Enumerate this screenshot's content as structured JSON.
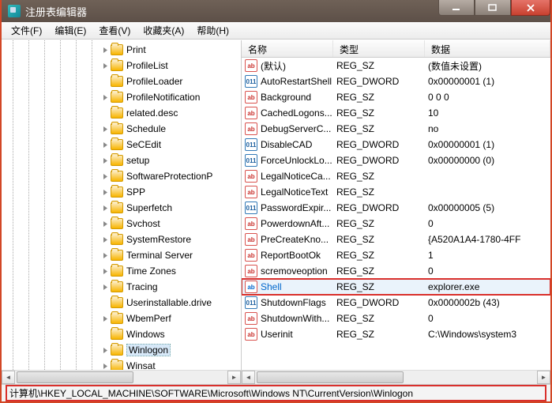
{
  "window": {
    "title": "注册表编辑器"
  },
  "menu": {
    "file": "文件(F)",
    "edit": "编辑(E)",
    "view": "查看(V)",
    "favorites": "收藏夹(A)",
    "help": "帮助(H)"
  },
  "tree": {
    "items": [
      {
        "label": "Print",
        "expandable": true
      },
      {
        "label": "ProfileList",
        "expandable": true
      },
      {
        "label": "ProfileLoader",
        "expandable": false
      },
      {
        "label": "ProfileNotification",
        "expandable": true
      },
      {
        "label": "related.desc",
        "expandable": false
      },
      {
        "label": "Schedule",
        "expandable": true
      },
      {
        "label": "SeCEdit",
        "expandable": true
      },
      {
        "label": "setup",
        "expandable": true
      },
      {
        "label": "SoftwareProtectionP",
        "expandable": true,
        "truncated": true
      },
      {
        "label": "SPP",
        "expandable": true
      },
      {
        "label": "Superfetch",
        "expandable": true
      },
      {
        "label": "Svchost",
        "expandable": true
      },
      {
        "label": "SystemRestore",
        "expandable": true
      },
      {
        "label": "Terminal Server",
        "expandable": true
      },
      {
        "label": "Time Zones",
        "expandable": true
      },
      {
        "label": "Tracing",
        "expandable": true
      },
      {
        "label": "Userinstallable.drive",
        "expandable": false,
        "truncated": true
      },
      {
        "label": "WbemPerf",
        "expandable": true
      },
      {
        "label": "Windows",
        "expandable": false
      },
      {
        "label": "Winlogon",
        "expandable": true,
        "selected": true
      },
      {
        "label": "Winsat",
        "expandable": true,
        "truncated": true
      }
    ]
  },
  "columns": {
    "name": "名称",
    "type": "类型",
    "data": "数据"
  },
  "values": [
    {
      "icon": "sz",
      "name": "(默认)",
      "type": "REG_SZ",
      "data": "(数值未设置)"
    },
    {
      "icon": "dw",
      "name": "AutoRestartShell",
      "type": "REG_DWORD",
      "data": "0x00000001 (1)"
    },
    {
      "icon": "sz",
      "name": "Background",
      "type": "REG_SZ",
      "data": "0 0 0"
    },
    {
      "icon": "sz",
      "name": "CachedLogons...",
      "type": "REG_SZ",
      "data": "10"
    },
    {
      "icon": "sz",
      "name": "DebugServerC...",
      "type": "REG_SZ",
      "data": "no"
    },
    {
      "icon": "dw",
      "name": "DisableCAD",
      "type": "REG_DWORD",
      "data": "0x00000001 (1)"
    },
    {
      "icon": "dw",
      "name": "ForceUnlockLo...",
      "type": "REG_DWORD",
      "data": "0x00000000 (0)"
    },
    {
      "icon": "sz",
      "name": "LegalNoticeCa...",
      "type": "REG_SZ",
      "data": ""
    },
    {
      "icon": "sz",
      "name": "LegalNoticeText",
      "type": "REG_SZ",
      "data": ""
    },
    {
      "icon": "dw",
      "name": "PasswordExpir...",
      "type": "REG_DWORD",
      "data": "0x00000005 (5)"
    },
    {
      "icon": "sz",
      "name": "PowerdownAft...",
      "type": "REG_SZ",
      "data": "0"
    },
    {
      "icon": "sz",
      "name": "PreCreateKno...",
      "type": "REG_SZ",
      "data": "{A520A1A4-1780-4FF"
    },
    {
      "icon": "sz",
      "name": "ReportBootOk",
      "type": "REG_SZ",
      "data": "1"
    },
    {
      "icon": "sz",
      "name": "scremoveoption",
      "type": "REG_SZ",
      "data": "0"
    },
    {
      "icon": "sz",
      "name": "Shell",
      "type": "REG_SZ",
      "data": "explorer.exe",
      "highlighted": true
    },
    {
      "icon": "dw",
      "name": "ShutdownFlags",
      "type": "REG_DWORD",
      "data": "0x0000002b (43)"
    },
    {
      "icon": "sz",
      "name": "ShutdownWith...",
      "type": "REG_SZ",
      "data": "0"
    },
    {
      "icon": "sz",
      "name": "Userinit",
      "type": "REG_SZ",
      "data": "C:\\Windows\\system3"
    }
  ],
  "statusbar": {
    "path": "计算机\\HKEY_LOCAL_MACHINE\\SOFTWARE\\Microsoft\\Windows NT\\CurrentVersion\\Winlogon"
  }
}
